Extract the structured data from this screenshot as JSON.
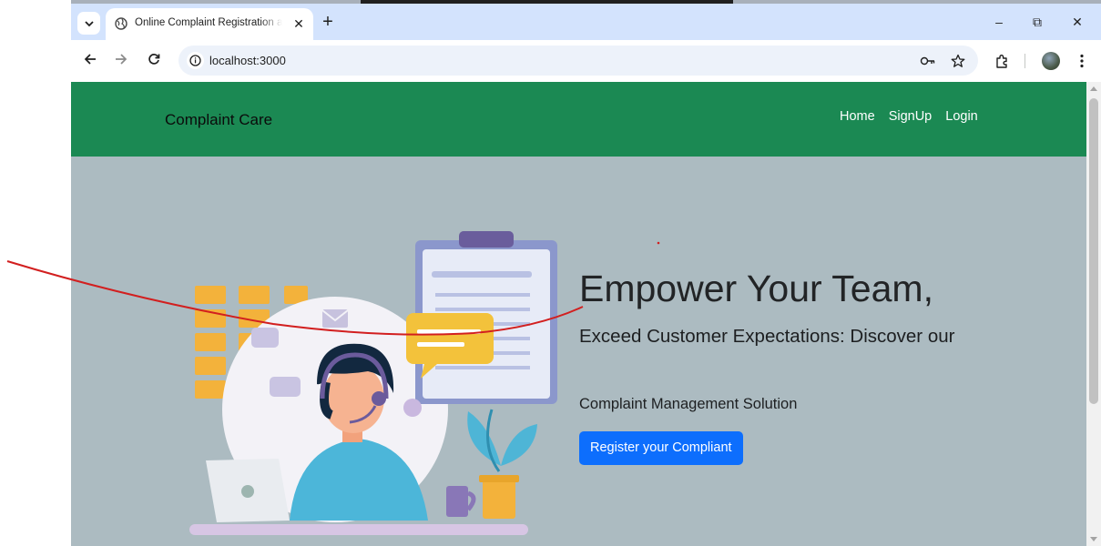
{
  "browser": {
    "tab_title": "Online Complaint Registration and Management System",
    "url": "localhost:3000",
    "new_tab_symbol": "+",
    "close_symbol": "✕",
    "window_minimize": "–",
    "window_restore": "⧉",
    "window_close": "✕"
  },
  "site": {
    "brand": "Complaint Care",
    "nav": [
      {
        "label": "Home"
      },
      {
        "label": "SignUp"
      },
      {
        "label": "Login"
      }
    ]
  },
  "hero": {
    "heading": "Empower Your Team,",
    "subheading": "Exceed Customer Expectations: Discover our",
    "tagline": "Complaint Management Solution",
    "cta_label": "Register your Compliant"
  },
  "colors": {
    "navbar": "#1b8953",
    "hero_bg": "#acbbc1",
    "cta": "#0d6efd",
    "annotation": "#d21f1f"
  },
  "icons": [
    "tab-search-icon",
    "globe-icon",
    "back-arrow-icon",
    "forward-arrow-icon",
    "reload-icon",
    "site-info-icon",
    "password-key-icon",
    "bookmark-star-icon",
    "extensions-icon",
    "profile-avatar",
    "more-menu-icon"
  ]
}
